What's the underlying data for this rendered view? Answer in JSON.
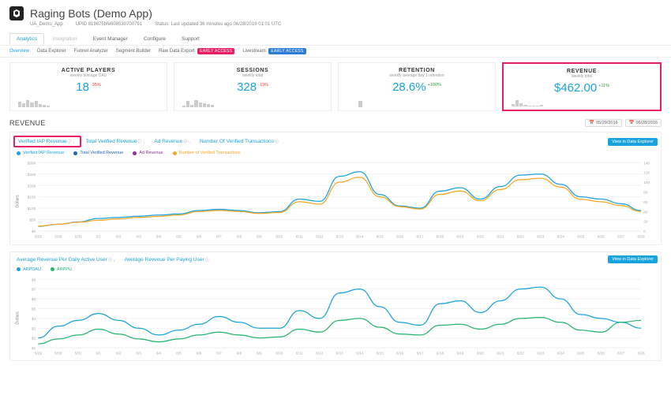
{
  "header": {
    "app_title": "Raging Bots (Demo App)",
    "project_label": "UA_Demo_App",
    "upid": "UPID 819875bfe608530700791",
    "status": "Status: Last updated 36 minutes ago 06/28/2016 01:01 UTC"
  },
  "tabs": {
    "analytics": "Analytics",
    "integration": "Integration",
    "event_manager": "Event Manager",
    "configure": "Configure",
    "support": "Support"
  },
  "subtabs": {
    "overview": "Overview",
    "data_explorer": "Data Explorer",
    "funnel_analyzer": "Funnel Analyzer",
    "segment_builder": "Segment Builder",
    "raw_data_export": "Raw Data Export",
    "livestream": "Livestream",
    "early_access": "EARLY ACCESS"
  },
  "metric_cards": [
    {
      "title": "ACTIVE PLAYERS",
      "subtitle": "weekly average DAU",
      "value": "18",
      "change": "-35%",
      "dir": "down",
      "spark": [
        7,
        5,
        9,
        6,
        8,
        4,
        3,
        2
      ]
    },
    {
      "title": "SESSIONS",
      "subtitle": "weekly total",
      "value": "328",
      "change": "-19%",
      "dir": "down",
      "spark": [
        2,
        8,
        3,
        9,
        6,
        5,
        4,
        3
      ]
    },
    {
      "title": "RETENTION",
      "subtitle": "weekly average day 1 retention",
      "value": "28.6%",
      "change": "+100%",
      "dir": "up",
      "spark": [
        0,
        0,
        0,
        8,
        0,
        0,
        0,
        0
      ]
    },
    {
      "title": "REVENUE",
      "subtitle": "weekly total",
      "value": "$462.00",
      "change": "+11%",
      "dir": "up",
      "spark": [
        3,
        8,
        4,
        2,
        1,
        1,
        1,
        2
      ]
    }
  ],
  "section": {
    "title": "REVENUE"
  },
  "dates": {
    "from": "05/29/2016",
    "to": "06/28/2016"
  },
  "chart1": {
    "metrics": [
      {
        "label": "Verified IAP Revenue",
        "selected": true
      },
      {
        "label": "Total Verified Revenue"
      },
      {
        "label": "Ad Revenue"
      },
      {
        "label": "Number Of Verified Transactions"
      }
    ],
    "view_btn": "View in Data Explorer",
    "legend": [
      {
        "label": "Verified IAP Revenue",
        "color": "#19A3DD"
      },
      {
        "label": "Total Verified Revenue",
        "color": "#1E66B0"
      },
      {
        "label": "Ad Revenue",
        "color": "#8E2DA0"
      },
      {
        "label": "Number of Verified Transactions",
        "color": "#F6A623"
      }
    ],
    "ylabel": "Dollars",
    "y_ticks": [
      "$300",
      "$250",
      "$200",
      "$150",
      "$100",
      "$50",
      "$0"
    ],
    "y2_ticks": [
      "140",
      "120",
      "100",
      "80",
      "60",
      "40",
      "20",
      "0"
    ]
  },
  "chart2": {
    "metrics": [
      {
        "label": "Average Revenue Per Daily Active User",
        "sep": ","
      },
      {
        "label": "Average Revenue Per Paying User"
      }
    ],
    "view_btn": "View in Data Explorer",
    "legend": [
      {
        "label": "ARPDAU",
        "color": "#19A3DD"
      },
      {
        "label": "ARPPU",
        "color": "#26B56E"
      }
    ],
    "ylabel": "Dollars",
    "y_ticks": [
      "$8",
      "$7",
      "$6",
      "$5",
      "$4",
      "$3",
      "$2",
      "$1"
    ]
  },
  "x_dates": [
    "5/29",
    "5/30",
    "5/31",
    "6/1",
    "6/2",
    "6/3",
    "6/4",
    "6/5",
    "6/6",
    "6/7",
    "6/8",
    "6/9",
    "6/10",
    "6/11",
    "6/12",
    "6/13",
    "6/14",
    "6/15",
    "6/16",
    "6/17",
    "6/18",
    "6/19",
    "6/20",
    "6/21",
    "6/22",
    "6/23",
    "6/24",
    "6/25",
    "6/26",
    "6/27",
    "6/28"
  ],
  "chart_data": [
    {
      "type": "line",
      "title": "Revenue",
      "xlabel": "",
      "ylabel": "Dollars",
      "y_axis_left": {
        "min": 0,
        "max": 300
      },
      "y_axis_right": {
        "min": 0,
        "max": 140
      },
      "x": [
        "5/29",
        "5/30",
        "5/31",
        "6/1",
        "6/2",
        "6/3",
        "6/4",
        "6/5",
        "6/6",
        "6/7",
        "6/8",
        "6/9",
        "6/10",
        "6/11",
        "6/12",
        "6/13",
        "6/14",
        "6/15",
        "6/16",
        "6/17",
        "6/18",
        "6/19",
        "6/20",
        "6/21",
        "6/22",
        "6/23",
        "6/24",
        "6/25",
        "6/26",
        "6/27",
        "6/28"
      ],
      "series": [
        {
          "name": "Verified IAP Revenue",
          "axis": "left",
          "values": [
            20,
            30,
            40,
            55,
            60,
            65,
            70,
            75,
            90,
            95,
            90,
            80,
            85,
            140,
            130,
            240,
            260,
            160,
            110,
            100,
            175,
            190,
            140,
            195,
            245,
            250,
            205,
            150,
            140,
            120,
            90
          ]
        },
        {
          "name": "Number of Verified Transactions",
          "axis": "right",
          "values": [
            10,
            14,
            18,
            22,
            25,
            28,
            30,
            33,
            40,
            42,
            40,
            36,
            38,
            60,
            55,
            100,
            110,
            70,
            50,
            45,
            75,
            82,
            62,
            85,
            105,
            108,
            90,
            65,
            60,
            52,
            40
          ]
        }
      ]
    },
    {
      "type": "line",
      "title": "ARPDAU / ARPPU",
      "xlabel": "",
      "ylabel": "Dollars",
      "ylim": [
        1,
        8
      ],
      "x": [
        "5/29",
        "5/30",
        "5/31",
        "6/1",
        "6/2",
        "6/3",
        "6/4",
        "6/5",
        "6/6",
        "6/7",
        "6/8",
        "6/9",
        "6/10",
        "6/11",
        "6/12",
        "6/13",
        "6/14",
        "6/15",
        "6/16",
        "6/17",
        "6/18",
        "6/19",
        "6/20",
        "6/21",
        "6/22",
        "6/23",
        "6/24",
        "6/25",
        "6/26",
        "6/27",
        "6/28"
      ],
      "series": [
        {
          "name": "ARPDAU",
          "values": [
            2.0,
            3.2,
            3.8,
            4.5,
            3.8,
            3.0,
            2.3,
            2.8,
            3.4,
            4.2,
            3.6,
            3.0,
            3.0,
            4.8,
            4.0,
            6.6,
            7.0,
            5.2,
            3.6,
            3.3,
            5.5,
            5.8,
            4.6,
            5.8,
            7.0,
            7.2,
            6.0,
            4.4,
            4.0,
            3.6,
            3.0
          ]
        },
        {
          "name": "ARPPU",
          "values": [
            1.4,
            1.9,
            2.3,
            2.9,
            2.4,
            1.9,
            1.6,
            1.9,
            2.3,
            2.6,
            2.3,
            2.0,
            2.1,
            2.9,
            2.6,
            3.8,
            4.0,
            3.1,
            2.4,
            2.3,
            3.3,
            3.4,
            2.9,
            3.4,
            4.0,
            4.1,
            3.6,
            2.8,
            2.6,
            3.6,
            3.8
          ]
        }
      ]
    }
  ]
}
